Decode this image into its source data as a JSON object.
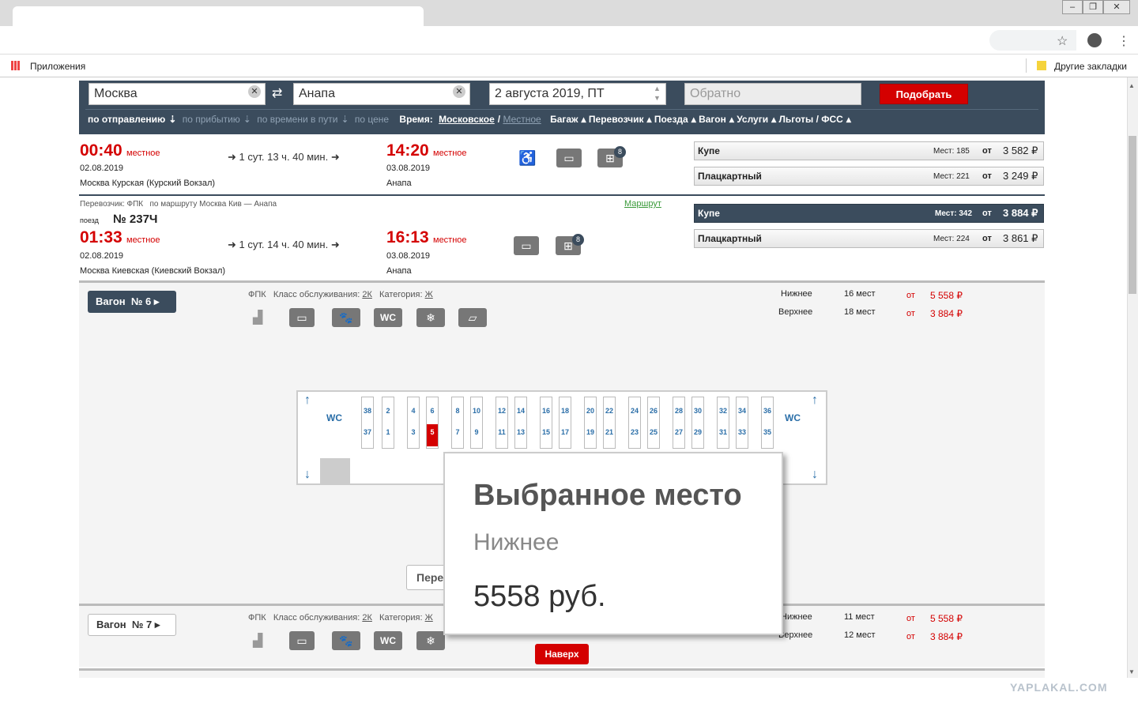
{
  "browser": {
    "bookmarks_apps": "Приложения",
    "bookmarks_other": "Другие закладки"
  },
  "search": {
    "from": "Москва",
    "to": "Анапа",
    "date": "2 августа 2019, ПТ",
    "return_placeholder": "Обратно",
    "submit": "Подобрать",
    "sort": [
      "по отправлению",
      "по прибытию",
      "по времени в пути",
      "по цене"
    ],
    "time_label": "Время:",
    "time_moscow": "Московское",
    "time_local": "Местное",
    "filters": [
      "Багаж",
      "Перевозчик",
      "Поезда",
      "Вагон",
      "Услуги",
      "Льготы / ФСС"
    ]
  },
  "train1": {
    "depart": "00:40",
    "depart_note": "местное",
    "duration": "1 сут. 13 ч. 40 мин.",
    "arrive": "14:20",
    "arrive_note": "местное",
    "depart_date": "02.08.2019",
    "arrive_date": "03.08.2019",
    "depart_station": "Москва Курская (Курский Вокзал)",
    "arrive_station": "Анапа",
    "badge": "8",
    "classes": [
      {
        "name": "Купе",
        "seats": "Мест: 185",
        "from": "от",
        "price": "3 582 ₽"
      },
      {
        "name": "Плацкартный",
        "seats": "Мест: 221",
        "from": "от",
        "price": "3 249 ₽"
      }
    ]
  },
  "train2": {
    "carrier": "Перевозчик: ФПК   по маршруту Москва Кив — Анапа",
    "route_link": "Маршрут",
    "poezd": "поезд",
    "number": "№ 237Ч",
    "depart": "01:33",
    "depart_note": "местное",
    "duration": "1 сут. 14 ч. 40 мин.",
    "arrive": "16:13",
    "arrive_note": "местное",
    "depart_date": "02.08.2019",
    "arrive_date": "03.08.2019",
    "depart_station": "Москва Киевская (Киевский Вокзал)",
    "arrive_station": "Анапа",
    "badge": "8",
    "classes": [
      {
        "name": "Купе",
        "seats": "Мест: 342",
        "from": "от",
        "price": "3 884 ₽"
      },
      {
        "name": "Плацкартный",
        "seats": "Мест: 224",
        "from": "от",
        "price": "3 861 ₽"
      }
    ]
  },
  "car6": {
    "button": "Вагон  № 6",
    "carrier": "ФПК",
    "class_label": "Класс обслуживания:",
    "class_value": "2К",
    "cat_label": "Категория:",
    "cat_value": "Ж",
    "lower_label": "Нижнее",
    "lower_count": "16 мест",
    "lower_from": "от",
    "lower_price": "5 558 ₽",
    "upper_label": "Верхнее",
    "upper_count": "18 мест",
    "upper_from": "от",
    "upper_price": "3 884 ₽",
    "wc": "WC",
    "upper_seats": [
      "38",
      "2",
      "4",
      "6",
      "8",
      "10",
      "12",
      "14",
      "16",
      "18",
      "20",
      "22",
      "24",
      "26",
      "28",
      "30",
      "32",
      "34",
      "36"
    ],
    "lower_seats": [
      "37",
      "1",
      "3",
      "5",
      "7",
      "9",
      "11",
      "13",
      "15",
      "17",
      "19",
      "21",
      "23",
      "25",
      "27",
      "29",
      "31",
      "33",
      "35"
    ],
    "selected_seat": "5",
    "partial_button": "Пере"
  },
  "popup": {
    "title": "Выбранное место",
    "type": "Нижнее",
    "price": "5558 руб."
  },
  "car7": {
    "button": "Вагон  № 7",
    "carrier": "ФПК",
    "class_label": "Класс обслуживания:",
    "class_value": "2К",
    "cat_label": "Категория:",
    "cat_value": "Ж",
    "lower_label": "Нижнее",
    "lower_count": "11 мест",
    "lower_from": "от",
    "lower_price": "5 558 ₽",
    "upper_label": "Верхнее",
    "upper_count": "12 мест",
    "upper_from": "от",
    "upper_price": "3 884 ₽"
  },
  "top_button": "Наверх",
  "watermark": "YAPLAKAL.COM",
  "colors": {
    "accent": "#d40000",
    "panel": "#3b4c5d",
    "seat_blue": "#2a6ea8"
  }
}
